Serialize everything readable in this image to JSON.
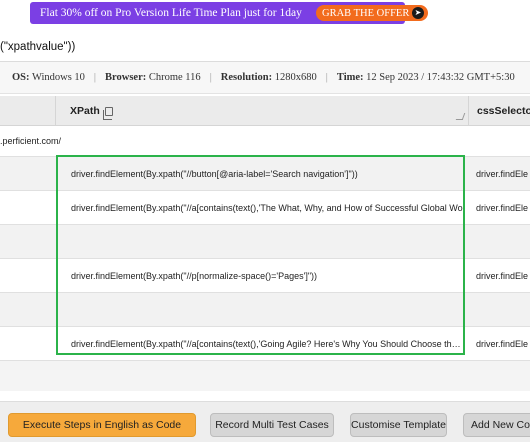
{
  "promo": {
    "text": "Flat 30% off on Pro Version Life Time Plan just for 1day",
    "button_label": "GRAB THE OFFER",
    "button_icon": "arrow-circle-icon",
    "colors": {
      "banner": "#7b3fe4",
      "button": "#f26b1d"
    }
  },
  "code_line": "(\"xpathvalue\"))",
  "env": {
    "os_label": "OS:",
    "os_value": "Windows 10",
    "browser_label": "Browser:",
    "browser_value": "Chrome 116",
    "resolution_label": "Resolution:",
    "resolution_value": "1280x680",
    "time_label": "Time:",
    "time_value": "12 Sep 2023 / 17:43:32 GMT+5:30",
    "separator": "|"
  },
  "table": {
    "columns": [
      "XPath",
      "cssSelector"
    ],
    "rows": [
      {
        "url": ".perficient.com/",
        "xpath": "",
        "css": ""
      },
      {
        "url": "",
        "xpath": "driver.findElement(By.xpath(\"//button[@aria-label='Search navigation']\"))",
        "css": "driver.findEle"
      },
      {
        "url": "",
        "xpath": "driver.findElement(By.xpath(\"//a[contains(text(),'The What, Why, and How of Successful Global Wo",
        "css": "driver.findEle"
      },
      {
        "url": "",
        "xpath": "",
        "css": ""
      },
      {
        "url": "",
        "xpath": "driver.findElement(By.xpath(\"//p[normalize-space()='Pages']\"))",
        "css": "driver.findEle"
      },
      {
        "url": "",
        "xpath": "",
        "css": ""
      },
      {
        "url": "",
        "xpath": "driver.findElement(By.xpath(\"//a[contains(text(),'Going Agile? Here's Why You Should Choose the Sc",
        "css": "driver.findEle"
      }
    ]
  },
  "footer": {
    "buttons": [
      "Execute Steps in English as Code",
      "Record Multi Test Cases",
      "Customise Template",
      "Add New Col"
    ],
    "colors": {
      "primary": "#f6a93b",
      "secondary": "#d6d6d6"
    }
  },
  "highlight_color": "#2bb34a"
}
